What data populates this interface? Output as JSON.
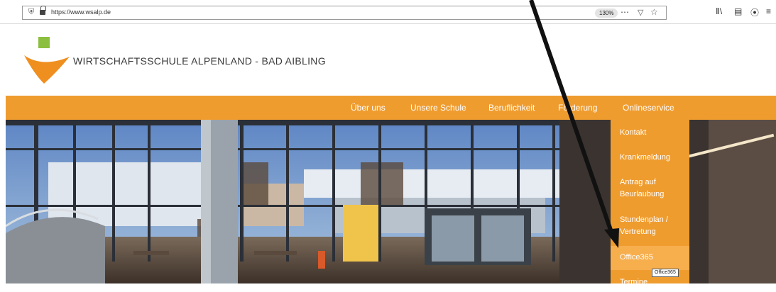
{
  "browser": {
    "url": "https://www.wsalp.de",
    "zoom": "130%",
    "icons": [
      "shield-icon",
      "lock-icon",
      "more-icon",
      "pocket-icon",
      "bookmark-star-icon",
      "library-icon",
      "sidebar-icon",
      "account-icon",
      "menu-icon"
    ]
  },
  "site": {
    "title": "WIRTSCHAFTSSCHULE ALPENLAND - BAD AIBLING",
    "colors": {
      "orange": "#ef9c2f",
      "orange_light": "#f7ae4d",
      "logo_green": "#8cbf3f"
    }
  },
  "nav": {
    "items": [
      {
        "label": "Über uns"
      },
      {
        "label": "Unsere Schule"
      },
      {
        "label": "Beruflichkeit"
      },
      {
        "label": "Förderung"
      },
      {
        "label": "Onlineservice"
      }
    ]
  },
  "dropdown": {
    "items": [
      {
        "label": "Kontakt"
      },
      {
        "label": "Krankmeldung"
      },
      {
        "label": "Antrag auf",
        "label2": "Beurlaubung"
      },
      {
        "label": "Stundenplan /",
        "label2": "Vertretung"
      },
      {
        "label": "Office365"
      },
      {
        "label": "Termine"
      }
    ],
    "tooltip": "Office365",
    "highlighted": "Office365"
  }
}
